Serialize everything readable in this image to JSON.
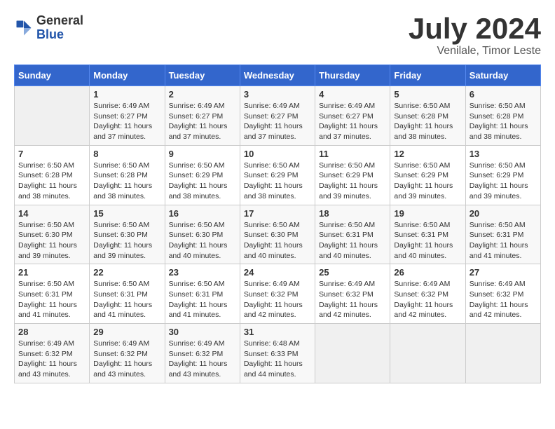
{
  "logo": {
    "general": "General",
    "blue": "Blue"
  },
  "title": {
    "month_year": "July 2024",
    "location": "Venilale, Timor Leste"
  },
  "weekdays": [
    "Sunday",
    "Monday",
    "Tuesday",
    "Wednesday",
    "Thursday",
    "Friday",
    "Saturday"
  ],
  "weeks": [
    [
      {
        "day": "",
        "info": ""
      },
      {
        "day": "1",
        "info": "Sunrise: 6:49 AM\nSunset: 6:27 PM\nDaylight: 11 hours\nand 37 minutes."
      },
      {
        "day": "2",
        "info": "Sunrise: 6:49 AM\nSunset: 6:27 PM\nDaylight: 11 hours\nand 37 minutes."
      },
      {
        "day": "3",
        "info": "Sunrise: 6:49 AM\nSunset: 6:27 PM\nDaylight: 11 hours\nand 37 minutes."
      },
      {
        "day": "4",
        "info": "Sunrise: 6:49 AM\nSunset: 6:27 PM\nDaylight: 11 hours\nand 37 minutes."
      },
      {
        "day": "5",
        "info": "Sunrise: 6:50 AM\nSunset: 6:28 PM\nDaylight: 11 hours\nand 38 minutes."
      },
      {
        "day": "6",
        "info": "Sunrise: 6:50 AM\nSunset: 6:28 PM\nDaylight: 11 hours\nand 38 minutes."
      }
    ],
    [
      {
        "day": "7",
        "info": "Sunrise: 6:50 AM\nSunset: 6:28 PM\nDaylight: 11 hours\nand 38 minutes."
      },
      {
        "day": "8",
        "info": "Sunrise: 6:50 AM\nSunset: 6:28 PM\nDaylight: 11 hours\nand 38 minutes."
      },
      {
        "day": "9",
        "info": "Sunrise: 6:50 AM\nSunset: 6:29 PM\nDaylight: 11 hours\nand 38 minutes."
      },
      {
        "day": "10",
        "info": "Sunrise: 6:50 AM\nSunset: 6:29 PM\nDaylight: 11 hours\nand 38 minutes."
      },
      {
        "day": "11",
        "info": "Sunrise: 6:50 AM\nSunset: 6:29 PM\nDaylight: 11 hours\nand 39 minutes."
      },
      {
        "day": "12",
        "info": "Sunrise: 6:50 AM\nSunset: 6:29 PM\nDaylight: 11 hours\nand 39 minutes."
      },
      {
        "day": "13",
        "info": "Sunrise: 6:50 AM\nSunset: 6:29 PM\nDaylight: 11 hours\nand 39 minutes."
      }
    ],
    [
      {
        "day": "14",
        "info": "Sunrise: 6:50 AM\nSunset: 6:30 PM\nDaylight: 11 hours\nand 39 minutes."
      },
      {
        "day": "15",
        "info": "Sunrise: 6:50 AM\nSunset: 6:30 PM\nDaylight: 11 hours\nand 39 minutes."
      },
      {
        "day": "16",
        "info": "Sunrise: 6:50 AM\nSunset: 6:30 PM\nDaylight: 11 hours\nand 40 minutes."
      },
      {
        "day": "17",
        "info": "Sunrise: 6:50 AM\nSunset: 6:30 PM\nDaylight: 11 hours\nand 40 minutes."
      },
      {
        "day": "18",
        "info": "Sunrise: 6:50 AM\nSunset: 6:31 PM\nDaylight: 11 hours\nand 40 minutes."
      },
      {
        "day": "19",
        "info": "Sunrise: 6:50 AM\nSunset: 6:31 PM\nDaylight: 11 hours\nand 40 minutes."
      },
      {
        "day": "20",
        "info": "Sunrise: 6:50 AM\nSunset: 6:31 PM\nDaylight: 11 hours\nand 41 minutes."
      }
    ],
    [
      {
        "day": "21",
        "info": "Sunrise: 6:50 AM\nSunset: 6:31 PM\nDaylight: 11 hours\nand 41 minutes."
      },
      {
        "day": "22",
        "info": "Sunrise: 6:50 AM\nSunset: 6:31 PM\nDaylight: 11 hours\nand 41 minutes."
      },
      {
        "day": "23",
        "info": "Sunrise: 6:50 AM\nSunset: 6:31 PM\nDaylight: 11 hours\nand 41 minutes."
      },
      {
        "day": "24",
        "info": "Sunrise: 6:49 AM\nSunset: 6:32 PM\nDaylight: 11 hours\nand 42 minutes."
      },
      {
        "day": "25",
        "info": "Sunrise: 6:49 AM\nSunset: 6:32 PM\nDaylight: 11 hours\nand 42 minutes."
      },
      {
        "day": "26",
        "info": "Sunrise: 6:49 AM\nSunset: 6:32 PM\nDaylight: 11 hours\nand 42 minutes."
      },
      {
        "day": "27",
        "info": "Sunrise: 6:49 AM\nSunset: 6:32 PM\nDaylight: 11 hours\nand 42 minutes."
      }
    ],
    [
      {
        "day": "28",
        "info": "Sunrise: 6:49 AM\nSunset: 6:32 PM\nDaylight: 11 hours\nand 43 minutes."
      },
      {
        "day": "29",
        "info": "Sunrise: 6:49 AM\nSunset: 6:32 PM\nDaylight: 11 hours\nand 43 minutes."
      },
      {
        "day": "30",
        "info": "Sunrise: 6:49 AM\nSunset: 6:32 PM\nDaylight: 11 hours\nand 43 minutes."
      },
      {
        "day": "31",
        "info": "Sunrise: 6:48 AM\nSunset: 6:33 PM\nDaylight: 11 hours\nand 44 minutes."
      },
      {
        "day": "",
        "info": ""
      },
      {
        "day": "",
        "info": ""
      },
      {
        "day": "",
        "info": ""
      }
    ]
  ]
}
